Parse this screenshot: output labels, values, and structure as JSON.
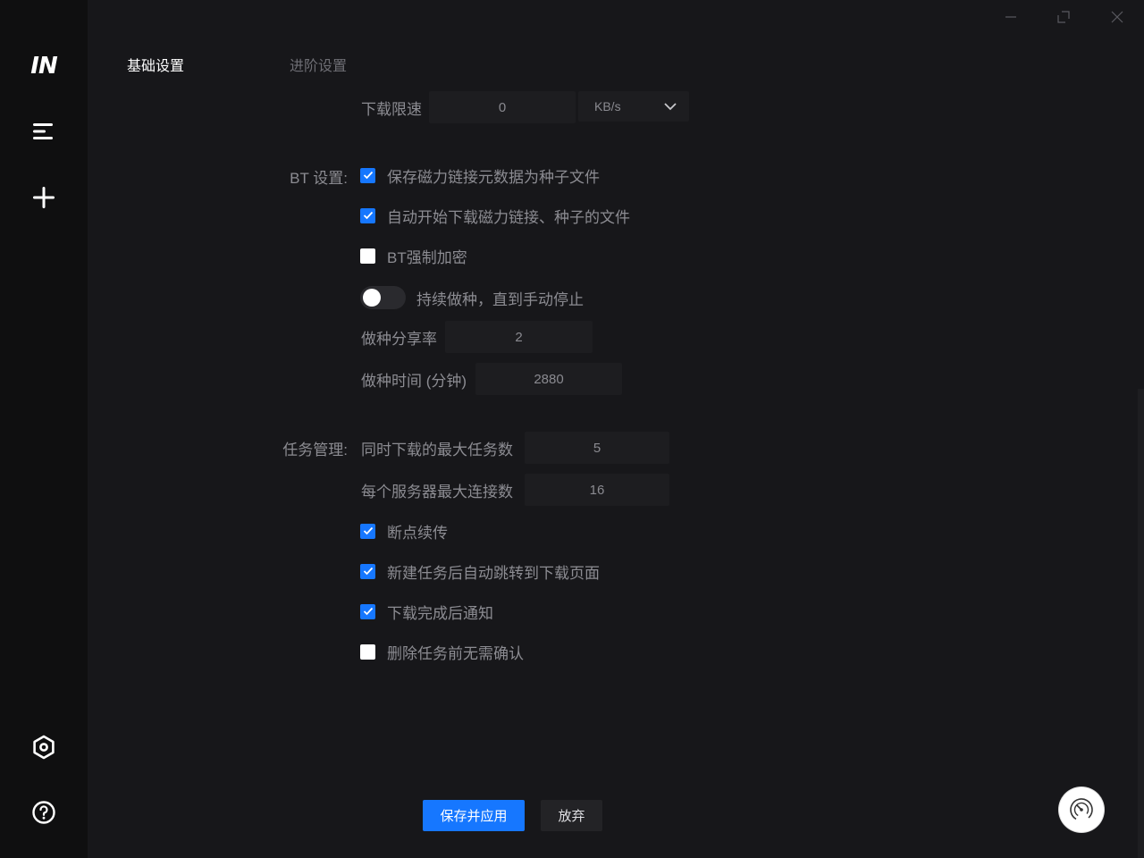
{
  "sidebar": {
    "logo_text": "IN",
    "icons": [
      "menu-icon",
      "plus-icon",
      "settings-icon",
      "help-icon"
    ]
  },
  "tabs": [
    {
      "label": "基础设置",
      "active": true
    },
    {
      "label": "进阶设置",
      "active": false
    }
  ],
  "speed_limit": {
    "label": "下载限速",
    "value": "0",
    "unit": "KB/s"
  },
  "bt": {
    "section_label": "BT 设置:",
    "options": [
      {
        "label": "保存磁力链接元数据为种子文件",
        "checked": true
      },
      {
        "label": "自动开始下载磁力链接、种子的文件",
        "checked": true
      },
      {
        "label": "BT强制加密",
        "checked": false
      }
    ],
    "seeding_toggle": {
      "label": "持续做种，直到手动停止",
      "on": false
    },
    "ratio": {
      "label": "做种分享率",
      "value": "2"
    },
    "time": {
      "label": "做种时间 (分钟)",
      "value": "2880"
    }
  },
  "task": {
    "section_label": "任务管理:",
    "max_tasks": {
      "label": "同时下载的最大任务数",
      "value": "5"
    },
    "max_conn": {
      "label": "每个服务器最大连接数",
      "value": "16"
    },
    "options": [
      {
        "label": "断点续传",
        "checked": true
      },
      {
        "label": "新建任务后自动跳转到下载页面",
        "checked": true
      },
      {
        "label": "下载完成后通知",
        "checked": true
      },
      {
        "label": "删除任务前无需确认",
        "checked": false
      }
    ]
  },
  "buttons": {
    "save": "保存并应用",
    "discard": "放弃"
  },
  "colors": {
    "accent": "#1677ff",
    "background": "#17171a",
    "sidebar": "#0f0f10"
  }
}
